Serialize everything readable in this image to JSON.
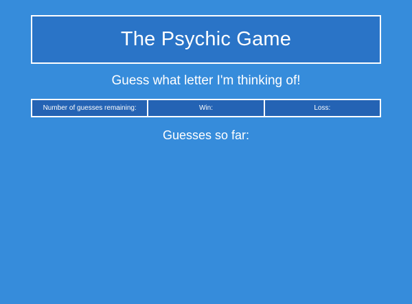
{
  "header": {
    "title": "The Psychic Game"
  },
  "prompt": {
    "text": "Guess what letter I'm thinking of!"
  },
  "stats": {
    "remaining_label": "Number of guesses remaining:",
    "win_label": "Win:",
    "loss_label": "Loss:"
  },
  "guesses": {
    "heading": "Guesses so far:",
    "letters": ""
  },
  "colors": {
    "background": "#368cdb",
    "title_bg": "#2a74c7",
    "stats_bg": "#2463b4",
    "border": "#ffffff"
  }
}
